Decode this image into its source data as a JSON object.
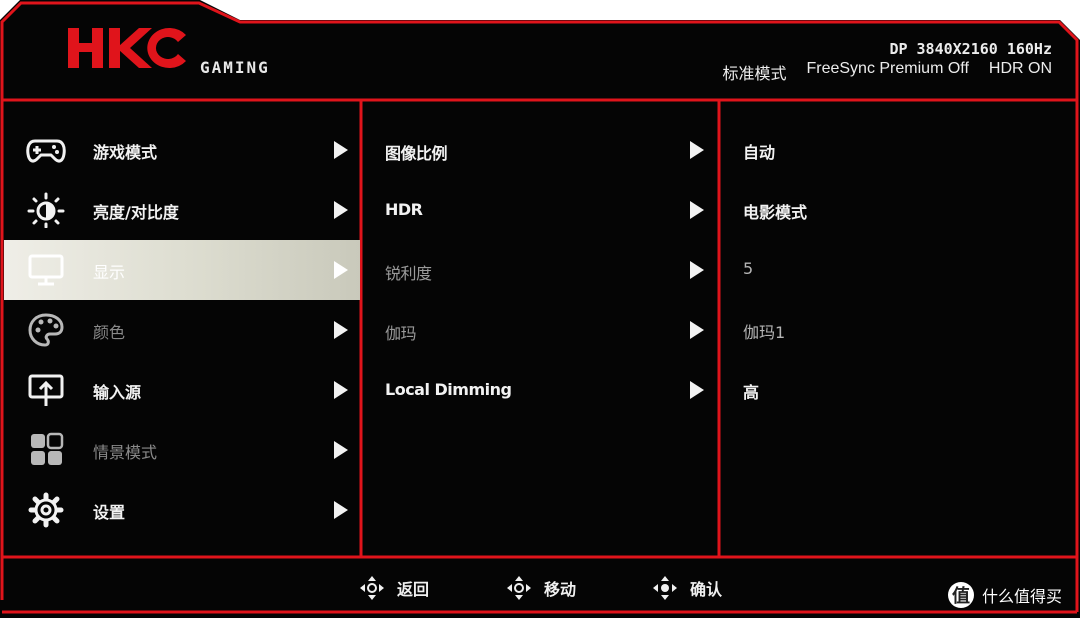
{
  "colors": {
    "background": "#050505",
    "frame": "#e0141b",
    "selected": "#e5e5dc",
    "text": "#f2f2f2",
    "dim_text": "#8a8a8a"
  },
  "header": {
    "brand_logo": "HKC",
    "brand_sub": "GAMING",
    "signal": "DP 3840X2160 160Hz",
    "mode": "标准模式",
    "freesync": "FreeSync Premium Off",
    "hdr": "HDR ON"
  },
  "main_menu": [
    {
      "label": "游戏模式",
      "icon": "gamepad-icon",
      "dim": false,
      "selected": false
    },
    {
      "label": "亮度/对比度",
      "icon": "brightness-icon",
      "dim": false,
      "selected": false
    },
    {
      "label": "显示",
      "icon": "monitor-icon",
      "dim": false,
      "selected": true
    },
    {
      "label": "颜色",
      "icon": "palette-icon",
      "dim": true,
      "selected": false
    },
    {
      "label": "输入源",
      "icon": "input-source-icon",
      "dim": false,
      "selected": false
    },
    {
      "label": "情景模式",
      "icon": "scene-mode-icon",
      "dim": true,
      "selected": false
    },
    {
      "label": "设置",
      "icon": "gear-icon",
      "dim": false,
      "selected": false
    }
  ],
  "sub_menu": [
    {
      "label": "图像比例",
      "dim": false
    },
    {
      "label": "HDR",
      "dim": false
    },
    {
      "label": "锐利度",
      "dim": true
    },
    {
      "label": "伽玛",
      "dim": true
    },
    {
      "label": "Local Dimming",
      "dim": false
    }
  ],
  "values": [
    {
      "label": "自动",
      "dim": false
    },
    {
      "label": "电影模式",
      "dim": false
    },
    {
      "label": "5",
      "dim": true
    },
    {
      "label": "伽玛1",
      "dim": true
    },
    {
      "label": "高",
      "dim": false
    }
  ],
  "footer": {
    "back": "返回",
    "move": "移动",
    "confirm": "确认"
  },
  "watermark": {
    "badge": "值",
    "text": "什么值得买"
  }
}
